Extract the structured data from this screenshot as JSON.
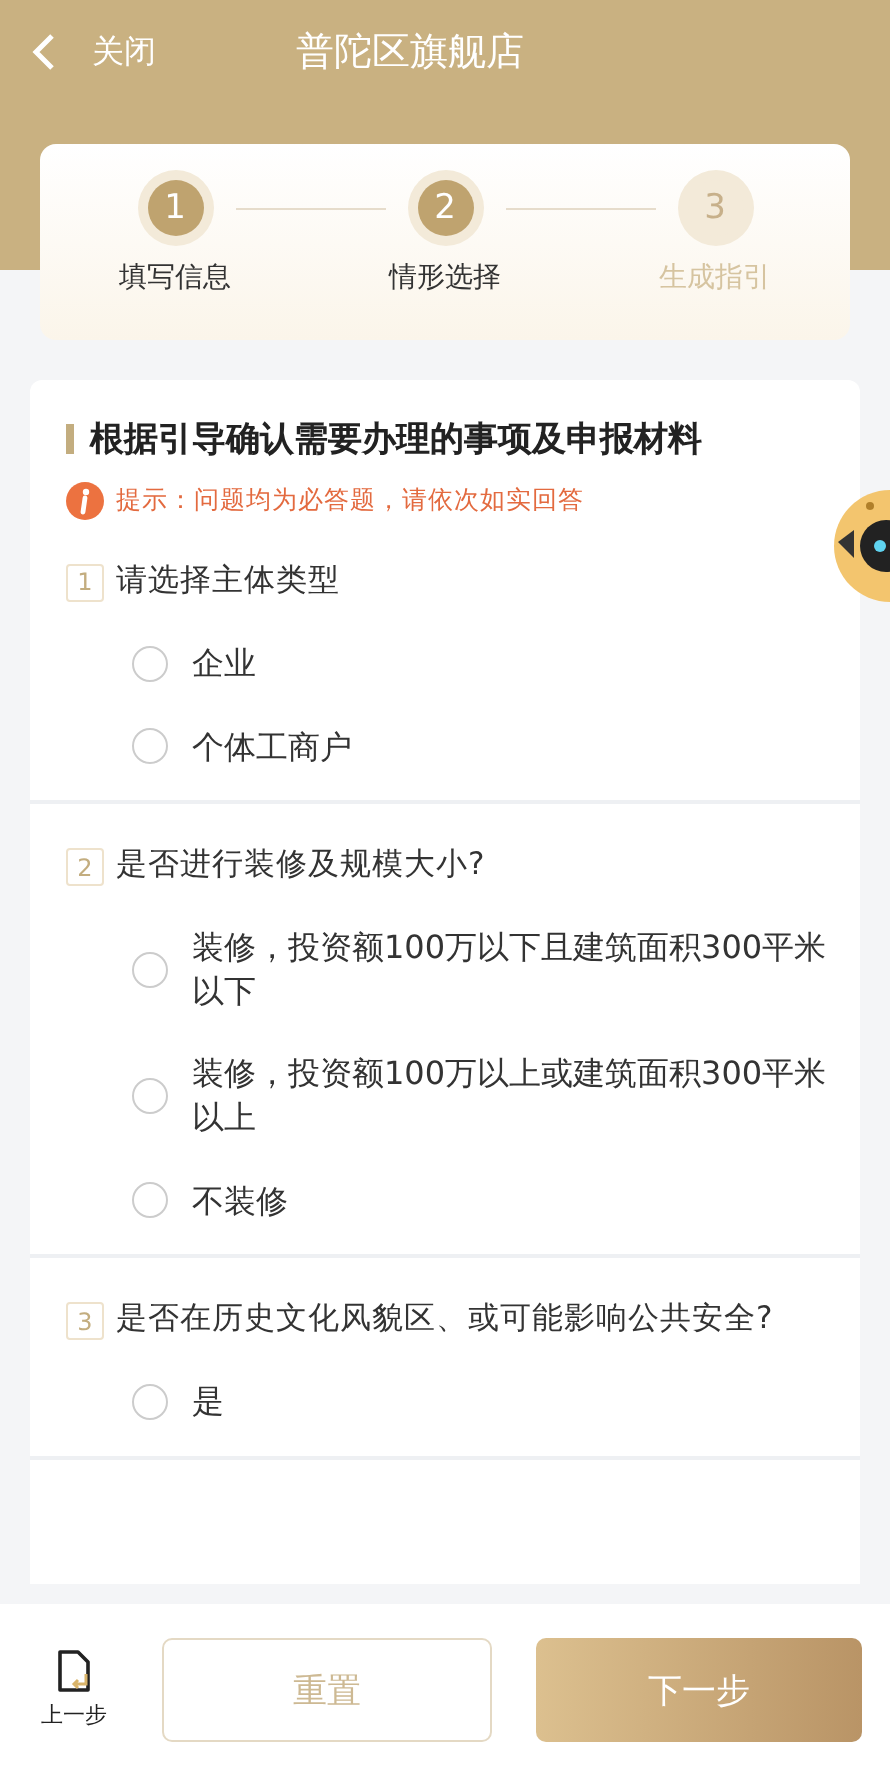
{
  "header": {
    "back": "关闭",
    "title": "普陀区旗舰店"
  },
  "steps": [
    {
      "number": "1",
      "label": "填写信息",
      "active": true
    },
    {
      "number": "2",
      "label": "情形选择",
      "active": true
    },
    {
      "number": "3",
      "label": "生成指引",
      "active": false
    }
  ],
  "form": {
    "heading": "根据引导确认需要办理的事项及申报材料",
    "tip": "提示：问题均为必答题，请依次如实回答",
    "questions": [
      {
        "number": "1",
        "text": "请选择主体类型",
        "options": [
          {
            "label": "企业",
            "selected": false
          },
          {
            "label": "个体工商户",
            "selected": false
          }
        ]
      },
      {
        "number": "2",
        "text": "是否进行装修及规模大小?",
        "options": [
          {
            "label": "装修，投资额100万以下且建筑面积300平米以下",
            "selected": false
          },
          {
            "label": "装修，投资额100万以上或建筑面积300平米以上",
            "selected": false
          },
          {
            "label": "不装修",
            "selected": false
          }
        ]
      },
      {
        "number": "3",
        "text": "是否在历史文化风貌区、或可能影响公共安全?",
        "options": [
          {
            "label": "是",
            "selected": false
          }
        ]
      }
    ]
  },
  "bottom": {
    "previous": "上一步",
    "reset": "重置",
    "next": "下一步"
  }
}
